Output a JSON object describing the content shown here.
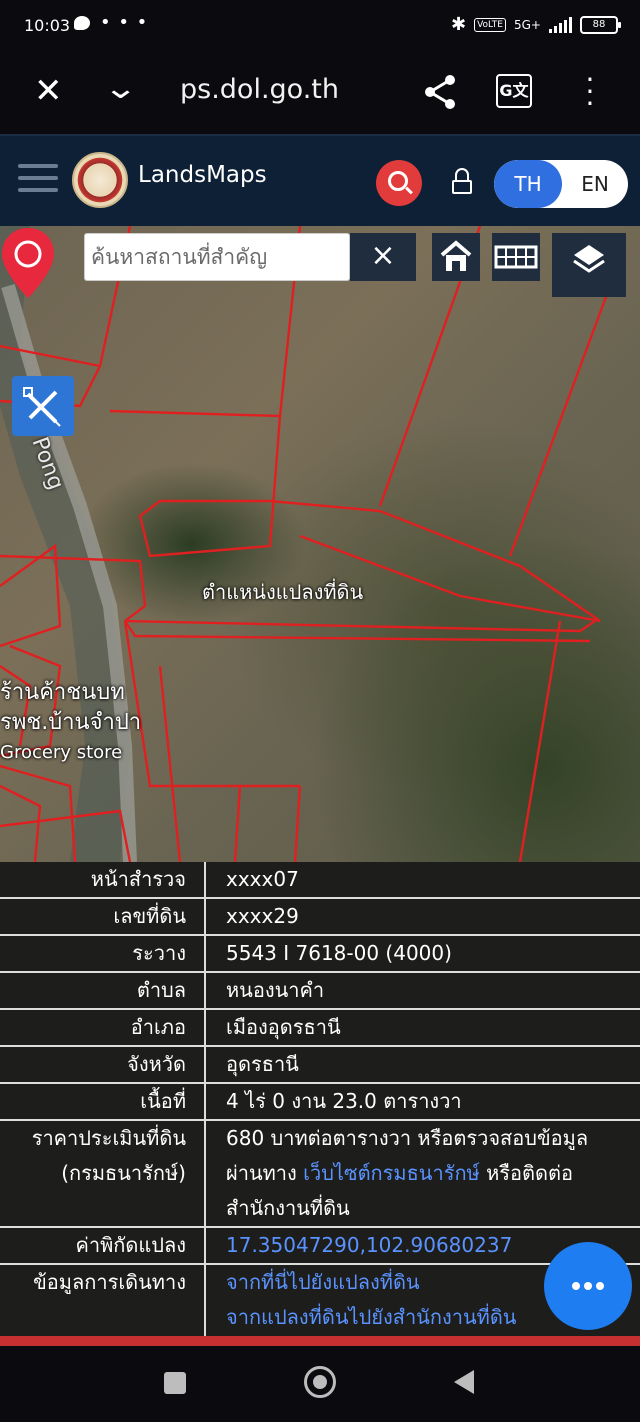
{
  "status_bar": {
    "time": "10:03",
    "dots": "• • •",
    "network": "5G+",
    "volte": "VoLTE",
    "battery": "88"
  },
  "browser": {
    "url": "ps.dol.go.th",
    "close_icon": "close-icon",
    "translate_label": "G文"
  },
  "header": {
    "app_name": "LandsMaps",
    "lang_th": "TH",
    "lang_en": "EN",
    "active_lang": "TH"
  },
  "map": {
    "search_placeholder": "ค้นหาสถานที่สำคัญ",
    "clear_label": "×",
    "road_label": "Pong",
    "pin_label": "ตำแหน่งแปลงที่ดิน",
    "poi_line1": "ร้านค้าชนบท",
    "poi_line2": "รพช.บ้านจำปา",
    "poi_line3": "Grocery store"
  },
  "info": {
    "rows": [
      {
        "key": "หน้าสำรวจ",
        "value": "xxxx07"
      },
      {
        "key": "เลขที่ดิน",
        "value": "xxxx29"
      },
      {
        "key": "ระวาง",
        "value": "5543 I 7618-00 (4000)"
      },
      {
        "key": "ตำบล",
        "value": "หนองนาคำ"
      },
      {
        "key": "อำเภอ",
        "value": "เมืองอุดรธานี"
      },
      {
        "key": "จังหวัด",
        "value": "อุดรธานี"
      },
      {
        "key": "เนื้อที่",
        "value": "4 ไร่ 0 งาน 23.0 ตารางวา"
      }
    ],
    "price_key_1": "ราคาประเมินที่ดิน",
    "price_key_2": "(กรมธนารักษ์)",
    "price_text_1": "680 บาทต่อตารางวา หรือตรวจสอบข้อมูล",
    "price_text_2": "ผ่านทาง",
    "price_link": "เว็บไซต์กรมธนารักษ์",
    "price_text_3": "หรือติดต่อ",
    "price_text_4": "สำนักงานที่ดิน",
    "coord_key": "ค่าพิกัดแปลง",
    "coord_value": "17.35047290,102.90680237",
    "travel_key": "ข้อมูลการเดินทาง",
    "travel_link_1": "จากที่นี่ไปยังแปลงที่ดิน",
    "travel_link_2": "จากแปลงที่ดินไปยังสำนักงานที่ดิน"
  },
  "colors": {
    "accent_blue": "#2f6fe0",
    "search_red": "#e23b3b",
    "parcel_red": "#e02020",
    "link_blue": "#5a93ff"
  }
}
